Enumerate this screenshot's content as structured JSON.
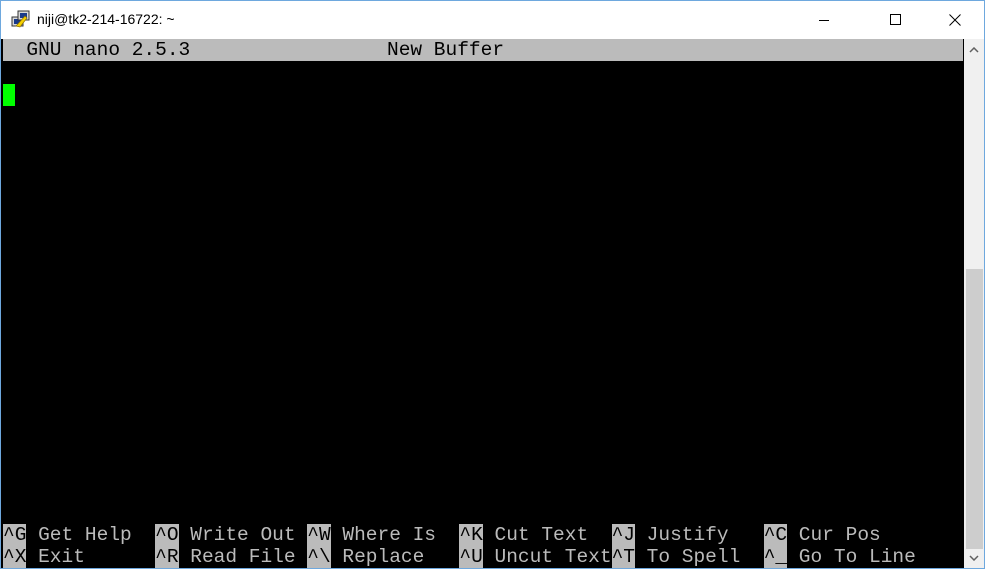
{
  "window": {
    "title": "niji@tk2-214-16722: ~",
    "app_icon": "putty-icon",
    "controls": {
      "minimize": "minimize-icon",
      "maximize": "maximize-icon",
      "close": "close-icon"
    }
  },
  "nano": {
    "version_label": "  GNU nano 2.5.3",
    "buffer_name": "New Buffer",
    "cursor_color": "#00ff00",
    "shortcuts": [
      [
        {
          "key": "^G",
          "label": " Get Help  "
        },
        {
          "key": "^O",
          "label": " Write Out "
        },
        {
          "key": "^W",
          "label": " Where Is  "
        },
        {
          "key": "^K",
          "label": " Cut Text  "
        },
        {
          "key": "^J",
          "label": " Justify   "
        },
        {
          "key": "^C",
          "label": " Cur Pos"
        }
      ],
      [
        {
          "key": "^X",
          "label": " Exit      "
        },
        {
          "key": "^R",
          "label": " Read File "
        },
        {
          "key": "^\\",
          "label": " Replace   "
        },
        {
          "key": "^U",
          "label": " Uncut Text"
        },
        {
          "key": "^T",
          "label": " To Spell  "
        },
        {
          "key": "^_",
          "label": " Go To Line"
        }
      ]
    ]
  },
  "colors": {
    "terminal_bg": "#000000",
    "terminal_fg": "#bbbbbb",
    "highlight_bg": "#bbbbbb",
    "cursor": "#00ff00"
  }
}
